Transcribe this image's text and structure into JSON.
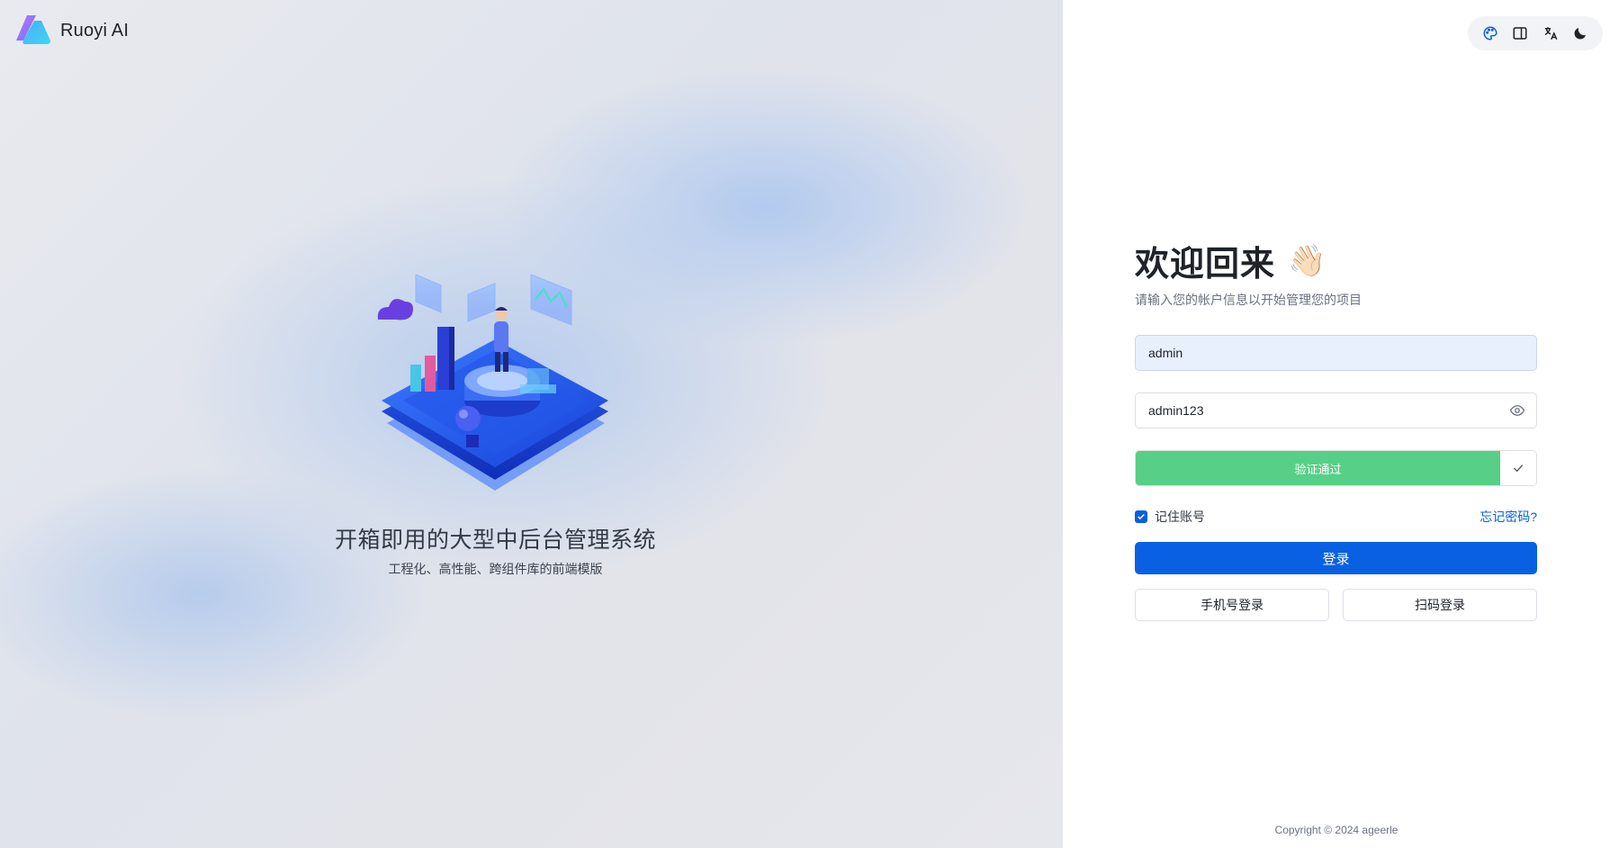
{
  "brand": {
    "name": "Ruoyi AI",
    "logo_icon": "ruoyi-logo-icon"
  },
  "hero": {
    "illustration_icon": "isometric-dashboard-illustration",
    "title": "开箱即用的大型中后台管理系统",
    "subtitle": "工程化、高性能、跨组件库的前端模版"
  },
  "toolbar": {
    "items": [
      {
        "icon": "palette-icon",
        "color": "#0960e3"
      },
      {
        "icon": "layout-panel-icon",
        "color": "#1f2329"
      },
      {
        "icon": "translate-icon",
        "color": "#1f2329"
      },
      {
        "icon": "moon-icon",
        "color": "#1f2329"
      }
    ]
  },
  "login": {
    "title": "欢迎回来",
    "title_emoji": "👋🏻",
    "subtitle": "请输入您的帐户信息以开始管理您的项目",
    "username_value": "admin",
    "password_value": "admin123",
    "password_toggle_icon": "eye-icon",
    "captcha_status": "验证通过",
    "captcha_check_icon": "check-icon",
    "remember_label": "记住账号",
    "remember_checked": true,
    "forgot_label": "忘记密码?",
    "submit_label": "登录",
    "phone_login_label": "手机号登录",
    "qr_login_label": "扫码登录"
  },
  "footer": {
    "copyright": "Copyright © 2024 ageerle"
  },
  "colors": {
    "primary": "#0960e3",
    "success": "#57cf87",
    "autofill": "#e8f0fe"
  }
}
